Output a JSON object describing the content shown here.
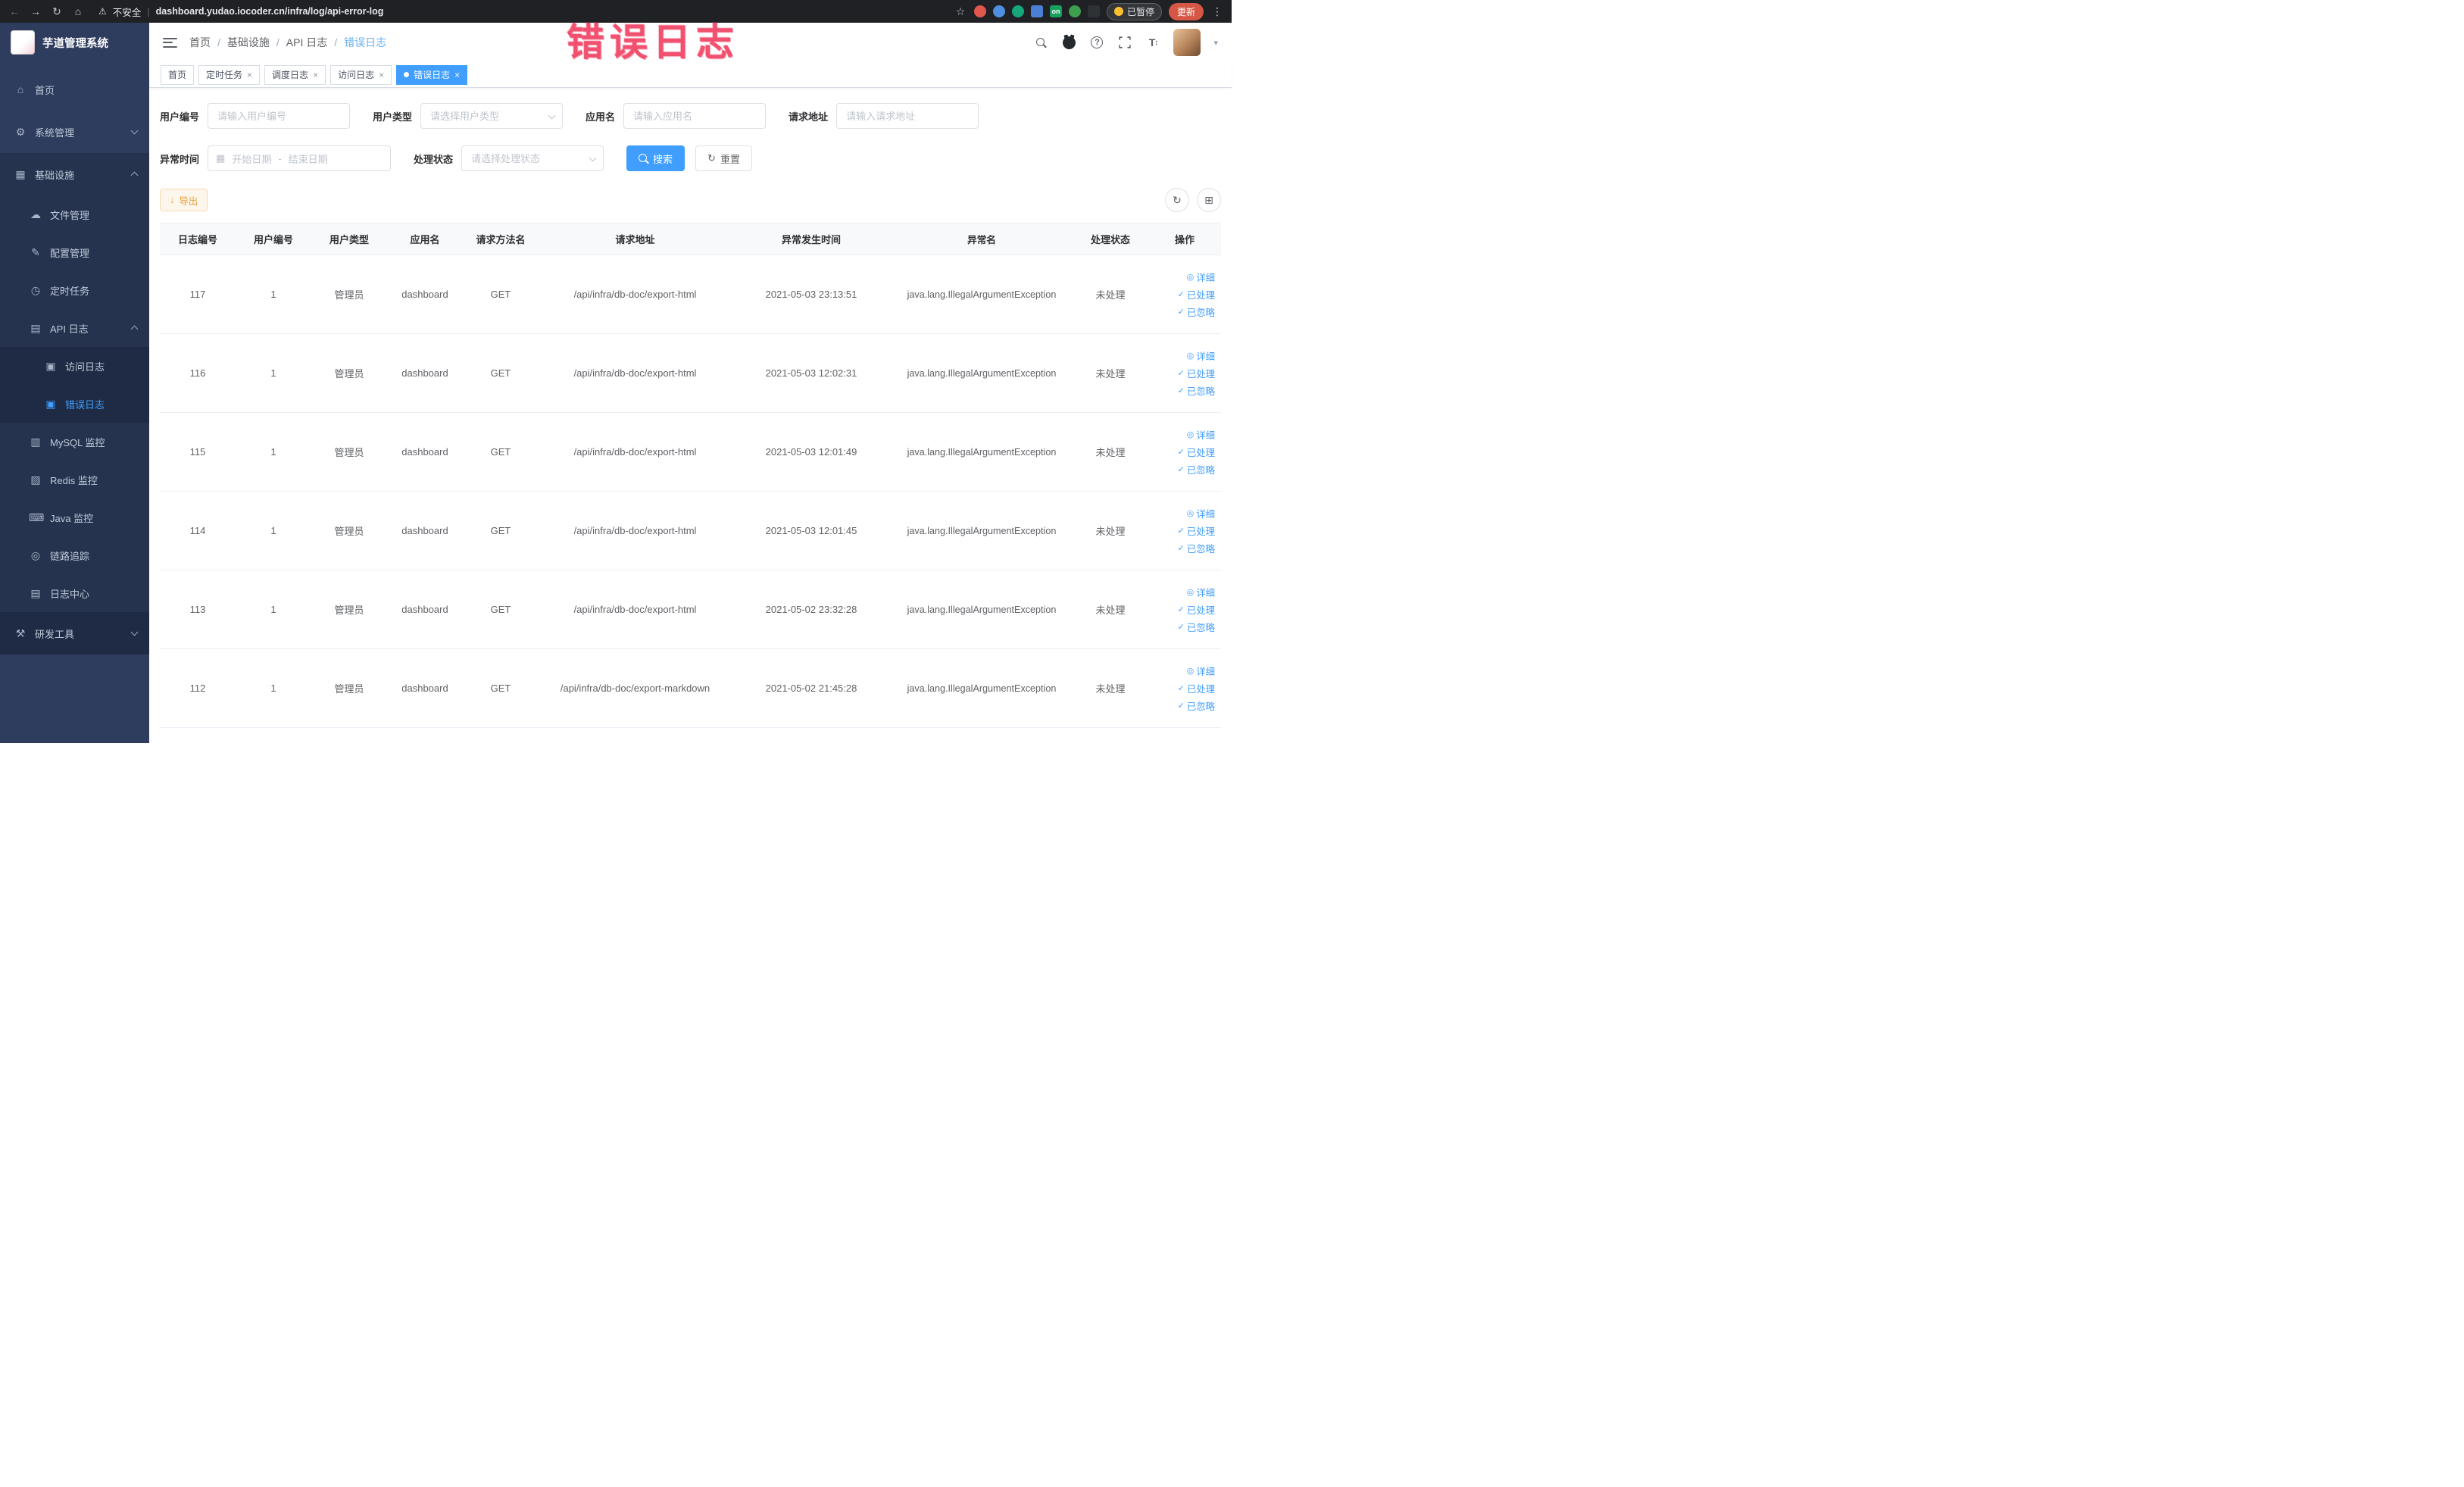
{
  "browser": {
    "security": "不安全",
    "divider": "|",
    "url": "dashboard.yudao.iocoder.cn/infra/log/api-error-log",
    "paused_label": "已暂停",
    "update_label": "更新"
  },
  "annotation": {
    "text": "错误日志"
  },
  "icons": {
    "back": "←",
    "forward": "→",
    "reload": "↻",
    "home": "⌂",
    "warning": "⚠",
    "star": "☆",
    "more": "⋮",
    "on_badge": "on",
    "close": "×",
    "question": "?",
    "font_size": "T",
    "font_arrows": "↕",
    "caret": "▾",
    "calendar": "▦",
    "download": "↓",
    "refresh": "↻",
    "columns": "⊞",
    "eye": "◎",
    "check": "✓",
    "menu_home": "⌂",
    "menu_system": "⚙",
    "menu_infra": "▦",
    "menu_file": "☁",
    "menu_config": "✎",
    "menu_job": "◷",
    "menu_api_log": "▤",
    "menu_access_log": "▣",
    "menu_error_log": "▣",
    "menu_mysql": "▥",
    "menu_redis": "▨",
    "menu_java": "⌨",
    "menu_trace": "◎",
    "menu_log_center": "▤",
    "menu_dev_tools": "⚒"
  },
  "sidebar": {
    "title": "芋道管理系统",
    "items": {
      "home": "首页",
      "system": "系统管理",
      "infra": "基础设施",
      "file": "文件管理",
      "config": "配置管理",
      "job": "定时任务",
      "api_log": "API 日志",
      "access_log": "访问日志",
      "error_log": "错误日志",
      "mysql": "MySQL 监控",
      "redis": "Redis 监控",
      "java": "Java 监控",
      "trace": "链路追踪",
      "log_center": "日志中心",
      "dev_tools": "研发工具"
    }
  },
  "navbar": {
    "separator": "/",
    "breadcrumb": [
      "首页",
      "基础设施",
      "API 日志",
      "错误日志"
    ]
  },
  "tabs": [
    {
      "label": "首页"
    },
    {
      "label": "定时任务"
    },
    {
      "label": "调度日志"
    },
    {
      "label": "访问日志"
    },
    {
      "label": "错误日志"
    }
  ],
  "filters": {
    "user_id": {
      "label": "用户编号",
      "placeholder": "请输入用户编号"
    },
    "user_type": {
      "label": "用户类型",
      "placeholder": "请选择用户类型"
    },
    "app_name": {
      "label": "应用名",
      "placeholder": "请输入应用名"
    },
    "request_url": {
      "label": "请求地址",
      "placeholder": "请输入请求地址"
    },
    "exception_time": {
      "label": "异常时间",
      "start_placeholder": "开始日期",
      "separator": "-",
      "end_placeholder": "结束日期"
    },
    "process_status": {
      "label": "处理状态",
      "placeholder": "请选择处理状态"
    },
    "search_label": "搜索",
    "reset_label": "重置"
  },
  "toolbar": {
    "export_label": "导出"
  },
  "table": {
    "columns": [
      "日志编号",
      "用户编号",
      "用户类型",
      "应用名",
      "请求方法名",
      "请求地址",
      "异常发生时间",
      "异常名",
      "处理状态",
      "操作"
    ],
    "actions": {
      "detail": "详细",
      "processed": "已处理",
      "ignored": "已忽略"
    },
    "rows": [
      {
        "id": "117",
        "user_id": "1",
        "user_type": "管理员",
        "app": "dashboard",
        "method": "GET",
        "url": "/api/infra/db-doc/export-html",
        "time": "2021-05-03 23:13:51",
        "exception": "java.lang.IllegalArgumentException",
        "status": "未处理"
      },
      {
        "id": "116",
        "user_id": "1",
        "user_type": "管理员",
        "app": "dashboard",
        "method": "GET",
        "url": "/api/infra/db-doc/export-html",
        "time": "2021-05-03 12:02:31",
        "exception": "java.lang.IllegalArgumentException",
        "status": "未处理"
      },
      {
        "id": "115",
        "user_id": "1",
        "user_type": "管理员",
        "app": "dashboard",
        "method": "GET",
        "url": "/api/infra/db-doc/export-html",
        "time": "2021-05-03 12:01:49",
        "exception": "java.lang.IllegalArgumentException",
        "status": "未处理"
      },
      {
        "id": "114",
        "user_id": "1",
        "user_type": "管理员",
        "app": "dashboard",
        "method": "GET",
        "url": "/api/infra/db-doc/export-html",
        "time": "2021-05-03 12:01:45",
        "exception": "java.lang.IllegalArgumentException",
        "status": "未处理"
      },
      {
        "id": "113",
        "user_id": "1",
        "user_type": "管理员",
        "app": "dashboard",
        "method": "GET",
        "url": "/api/infra/db-doc/export-html",
        "time": "2021-05-02 23:32:28",
        "exception": "java.lang.IllegalArgumentException",
        "status": "未处理"
      },
      {
        "id": "112",
        "user_id": "1",
        "user_type": "管理员",
        "app": "dashboard",
        "method": "GET",
        "url": "/api/infra/db-doc/export-markdown",
        "time": "2021-05-02 21:45:28",
        "exception": "java.lang.IllegalArgumentException",
        "status": "未处理"
      }
    ]
  }
}
